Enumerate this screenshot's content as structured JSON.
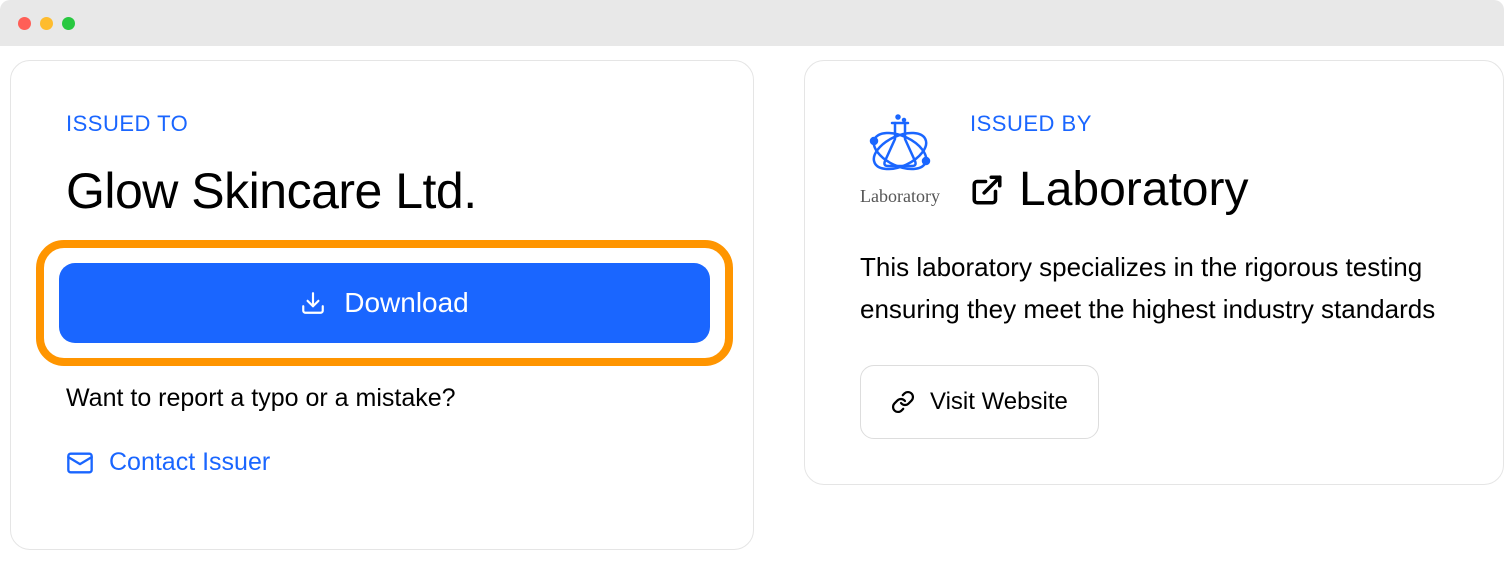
{
  "issued_to": {
    "label": "ISSUED TO",
    "company_name": "Glow Skincare Ltd.",
    "download_label": "Download",
    "report_text": "Want to report a typo or a mistake?",
    "contact_link": "Contact Issuer"
  },
  "issued_by": {
    "label": "ISSUED BY",
    "logo_text": "Laboratory",
    "name": "Laboratory",
    "description": "This laboratory specializes in the rigorous testing ensuring they meet the highest industry standards",
    "visit_label": "Visit Website"
  },
  "colors": {
    "primary_blue": "#1a66ff",
    "highlight_orange": "#ff9500"
  }
}
